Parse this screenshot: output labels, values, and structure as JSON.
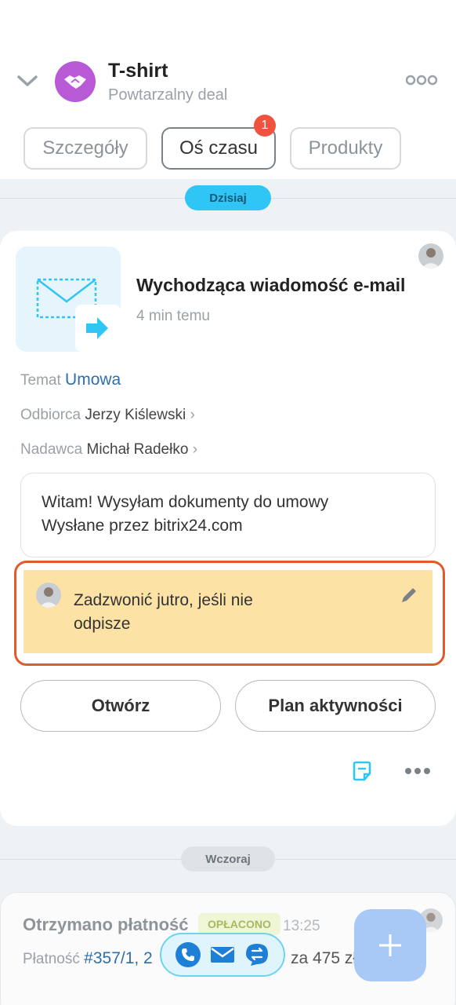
{
  "header": {
    "title": "T-shirt",
    "subtitle": "Powtarzalny deal",
    "back_icon": "chevron-down-icon",
    "deal_icon": "handshake-icon",
    "more_icon": "more-dots-icon",
    "avatar_color": "#b85ad6"
  },
  "tabs": [
    {
      "label": "Szczegóły",
      "active": false
    },
    {
      "label": "Oś czasu",
      "active": true,
      "badge": "1"
    },
    {
      "label": "Produkty",
      "active": false
    }
  ],
  "timeline": {
    "today_label": "Dzisiaj",
    "yesterday_label": "Wczoraj",
    "activity": {
      "title": "Wychodząca wiadomość e-mail",
      "time": "4 min temu",
      "subject_label": "Temat",
      "subject_value": "Umowa",
      "recipient_label": "Odbiorca",
      "recipient_value": "Jerzy Kiślewski",
      "sender_label": "Nadawca",
      "sender_value": "Michał Radełko",
      "message_line1": "Witam! Wysyłam dokumenty do umowy",
      "message_line2": "Wysłane przez bitrix24.com",
      "note_text": "Zadzwonić jutro, jeśli nie odpisze",
      "open_button": "Otwórz",
      "plan_button": "Plan aktywności"
    },
    "payment": {
      "title": "Otrzymano płatność",
      "status": "OPŁACONO",
      "time": "13:25",
      "label": "Płatność",
      "link": "#357/1, 2",
      "amount": "za 475 zł"
    }
  },
  "colors": {
    "accent_blue": "#2fc6f6",
    "badge_red": "#f0533d",
    "note_bg": "#fde2a6",
    "highlight_frame": "#e05a2b"
  }
}
